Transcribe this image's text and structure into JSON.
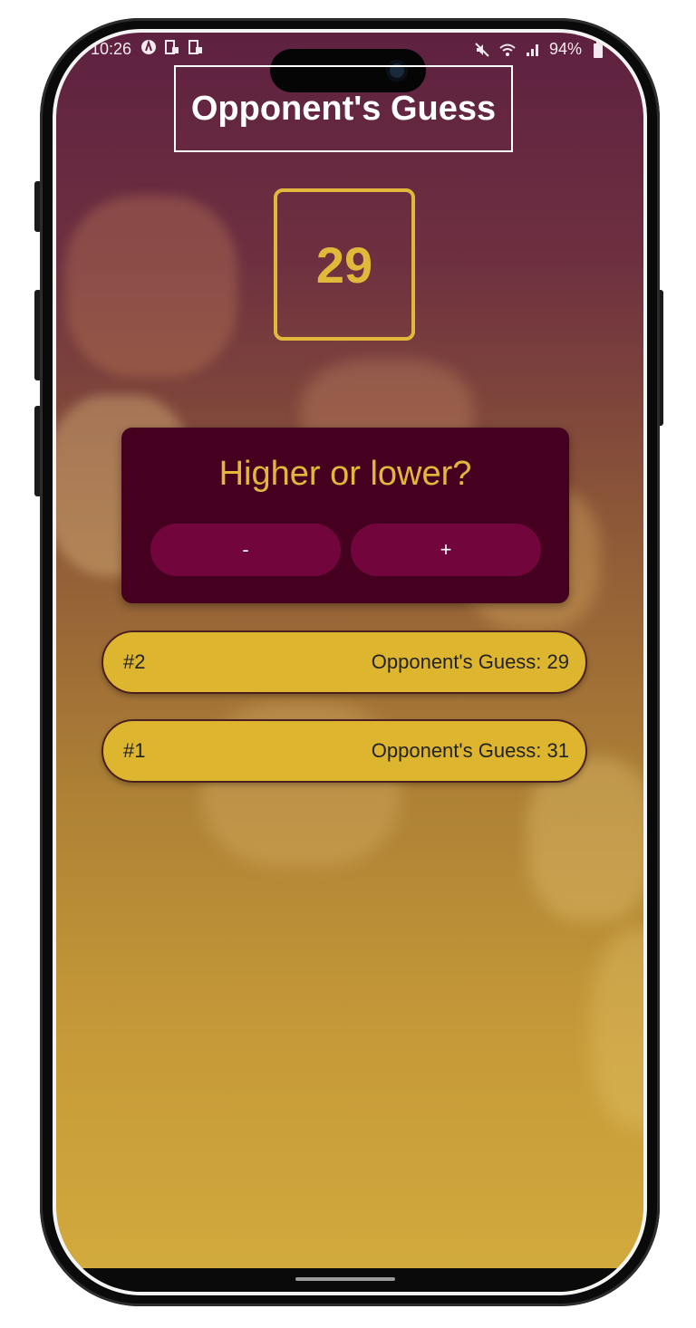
{
  "status_bar": {
    "time": "10:26",
    "battery": "94%",
    "icons": [
      "react-icon",
      "cast-icon",
      "cast-icon",
      "mute-icon",
      "wifi-icon",
      "signal-icon",
      "battery-icon"
    ]
  },
  "header": {
    "title": "Opponent's Guess"
  },
  "guess": {
    "value": "29"
  },
  "controls": {
    "prompt": "Higher or lower?",
    "lower_label": "-",
    "higher_label": "+"
  },
  "log": [
    {
      "round": "#2",
      "text": "Opponent's Guess: 29"
    },
    {
      "round": "#1",
      "text": "Opponent's Guess: 31"
    }
  ],
  "colors": {
    "accent": "#e2b83a",
    "card": "#46001f",
    "button": "#72063c",
    "log_item": "#ddb52f"
  }
}
